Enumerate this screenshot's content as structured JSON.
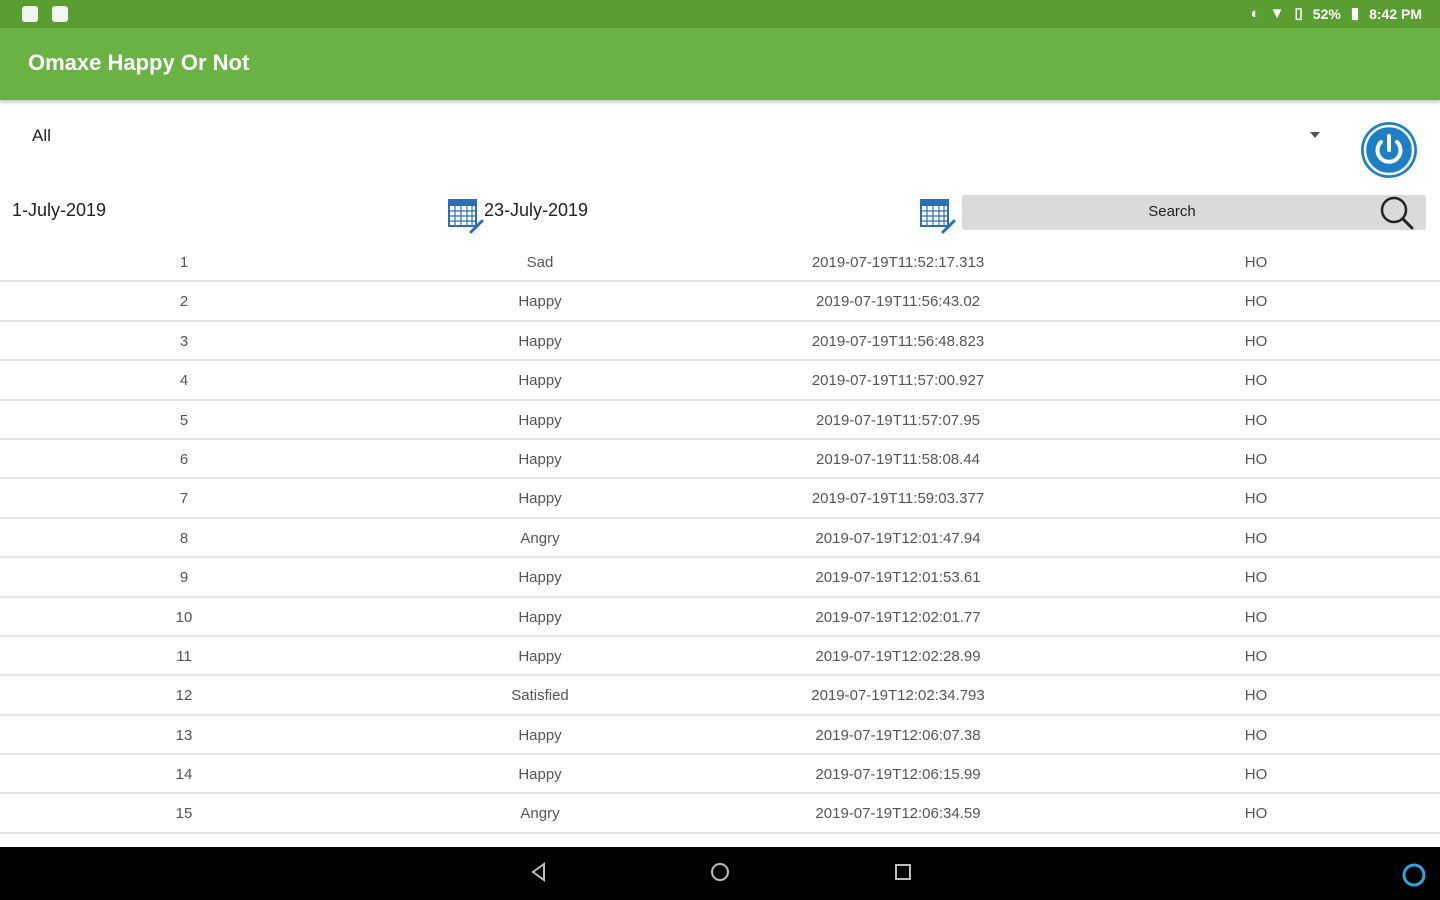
{
  "status_bar": {
    "battery": "52%",
    "time": "8:42 PM"
  },
  "app_bar": {
    "title": "Omaxe Happy Or Not"
  },
  "filter": {
    "selected": "All"
  },
  "dates": {
    "from": "1-July-2019",
    "to": "23-July-2019"
  },
  "search": {
    "label": "Search"
  },
  "colors": {
    "status_bar": "#5a9e32",
    "app_bar": "#6ab244",
    "accent": "#1d80c6"
  },
  "rows": [
    {
      "num": "1",
      "mood": "Sad",
      "time": "2019-07-19T11:52:17.313",
      "location": "HO"
    },
    {
      "num": "2",
      "mood": "Happy",
      "time": "2019-07-19T11:56:43.02",
      "location": "HO"
    },
    {
      "num": "3",
      "mood": "Happy",
      "time": "2019-07-19T11:56:48.823",
      "location": "HO"
    },
    {
      "num": "4",
      "mood": "Happy",
      "time": "2019-07-19T11:57:00.927",
      "location": "HO"
    },
    {
      "num": "5",
      "mood": "Happy",
      "time": "2019-07-19T11:57:07.95",
      "location": "HO"
    },
    {
      "num": "6",
      "mood": "Happy",
      "time": "2019-07-19T11:58:08.44",
      "location": "HO"
    },
    {
      "num": "7",
      "mood": "Happy",
      "time": "2019-07-19T11:59:03.377",
      "location": "HO"
    },
    {
      "num": "8",
      "mood": "Angry",
      "time": "2019-07-19T12:01:47.94",
      "location": "HO"
    },
    {
      "num": "9",
      "mood": "Happy",
      "time": "2019-07-19T12:01:53.61",
      "location": "HO"
    },
    {
      "num": "10",
      "mood": "Happy",
      "time": "2019-07-19T12:02:01.77",
      "location": "HO"
    },
    {
      "num": "11",
      "mood": "Happy",
      "time": "2019-07-19T12:02:28.99",
      "location": "HO"
    },
    {
      "num": "12",
      "mood": "Satisfied",
      "time": "2019-07-19T12:02:34.793",
      "location": "HO"
    },
    {
      "num": "13",
      "mood": "Happy",
      "time": "2019-07-19T12:06:07.38",
      "location": "HO"
    },
    {
      "num": "14",
      "mood": "Happy",
      "time": "2019-07-19T12:06:15.99",
      "location": "HO"
    },
    {
      "num": "15",
      "mood": "Angry",
      "time": "2019-07-19T12:06:34.59",
      "location": "HO"
    }
  ]
}
